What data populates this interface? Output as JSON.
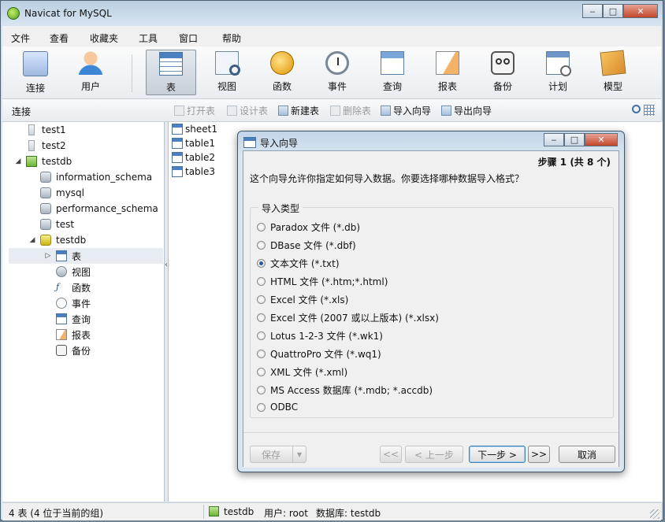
{
  "window": {
    "title": "Navicat for MySQL",
    "controls": {
      "minimize": "‒",
      "maximize": "□",
      "close": "✕"
    }
  },
  "menu": [
    "文件",
    "查看",
    "收藏夹",
    "工具",
    "窗口",
    "帮助"
  ],
  "toolbar": [
    {
      "label": "连接",
      "icon": "connection-icon"
    },
    {
      "label": "用户",
      "icon": "user-icon"
    },
    {
      "label": "表",
      "icon": "table-icon",
      "active": true
    },
    {
      "label": "视图",
      "icon": "view-icon"
    },
    {
      "label": "函数",
      "icon": "function-icon"
    },
    {
      "label": "事件",
      "icon": "event-icon"
    },
    {
      "label": "查询",
      "icon": "query-icon"
    },
    {
      "label": "报表",
      "icon": "report-icon"
    },
    {
      "label": "备份",
      "icon": "backup-icon"
    },
    {
      "label": "计划",
      "icon": "schedule-icon"
    },
    {
      "label": "模型",
      "icon": "model-icon"
    }
  ],
  "subbar": {
    "connections_label": "连接",
    "actions": [
      {
        "label": "打开表",
        "enabled": false
      },
      {
        "label": "设计表",
        "enabled": false
      },
      {
        "label": "新建表",
        "enabled": true
      },
      {
        "label": "删除表",
        "enabled": false
      },
      {
        "label": "导入向导",
        "enabled": true
      },
      {
        "label": "导出向导",
        "enabled": true
      }
    ]
  },
  "tree": [
    {
      "label": "test1",
      "type": "server-closed"
    },
    {
      "label": "test2",
      "type": "server-closed"
    },
    {
      "label": "testdb",
      "type": "server-open",
      "expanded": true
    },
    {
      "label": "information_schema",
      "type": "database"
    },
    {
      "label": "mysql",
      "type": "database"
    },
    {
      "label": "performance_schema",
      "type": "database"
    },
    {
      "label": "test",
      "type": "database"
    },
    {
      "label": "testdb",
      "type": "database-open",
      "expanded": true
    },
    {
      "label": "表",
      "type": "tables",
      "selected": true
    },
    {
      "label": "视图",
      "type": "views"
    },
    {
      "label": "函数",
      "type": "functions"
    },
    {
      "label": "事件",
      "type": "events"
    },
    {
      "label": "查询",
      "type": "queries"
    },
    {
      "label": "报表",
      "type": "reports"
    },
    {
      "label": "备份",
      "type": "backups"
    }
  ],
  "tables": [
    "sheet1",
    "table1",
    "table2",
    "table3"
  ],
  "status": {
    "count": "4 表 (4 位于当前的组)",
    "connection": "testdb",
    "user": "用户: root",
    "database": "数据库: testdb"
  },
  "dialog": {
    "title": "导入向导",
    "controls": {
      "minimize": "‒",
      "maximize": "□",
      "close": "✕"
    },
    "step": "步骤 1 (共 8 个)",
    "intro": "这个向导允许你指定如何导入数据。你要选择哪种数据导入格式？",
    "group_label": "导入类型",
    "options": [
      {
        "label": "Paradox 文件 (*.db)",
        "checked": false
      },
      {
        "label": "DBase 文件 (*.dbf)",
        "checked": false
      },
      {
        "label": "文本文件 (*.txt)",
        "checked": true
      },
      {
        "label": "HTML 文件 (*.htm;*.html)",
        "checked": false
      },
      {
        "label": "Excel 文件 (*.xls)",
        "checked": false
      },
      {
        "label": "Excel 文件 (2007 或以上版本) (*.xlsx)",
        "checked": false
      },
      {
        "label": "Lotus 1-2-3 文件 (*.wk1)",
        "checked": false
      },
      {
        "label": "QuattroPro 文件 (*.wq1)",
        "checked": false
      },
      {
        "label": "XML 文件 (*.xml)",
        "checked": false
      },
      {
        "label": "MS Access 数据库 (*.mdb; *.accdb)",
        "checked": false
      },
      {
        "label": "ODBC",
        "checked": false
      }
    ],
    "buttons": {
      "save": "保存",
      "save_arrow": "▼",
      "first": "<<",
      "back": "< 上一步",
      "next": "下一步 >",
      "last": ">>",
      "cancel": "取消"
    }
  },
  "colors": {
    "accent": "#4a7fc0",
    "selected_bg": "#e7ecf2",
    "title_bg": "#c2d5e8"
  }
}
